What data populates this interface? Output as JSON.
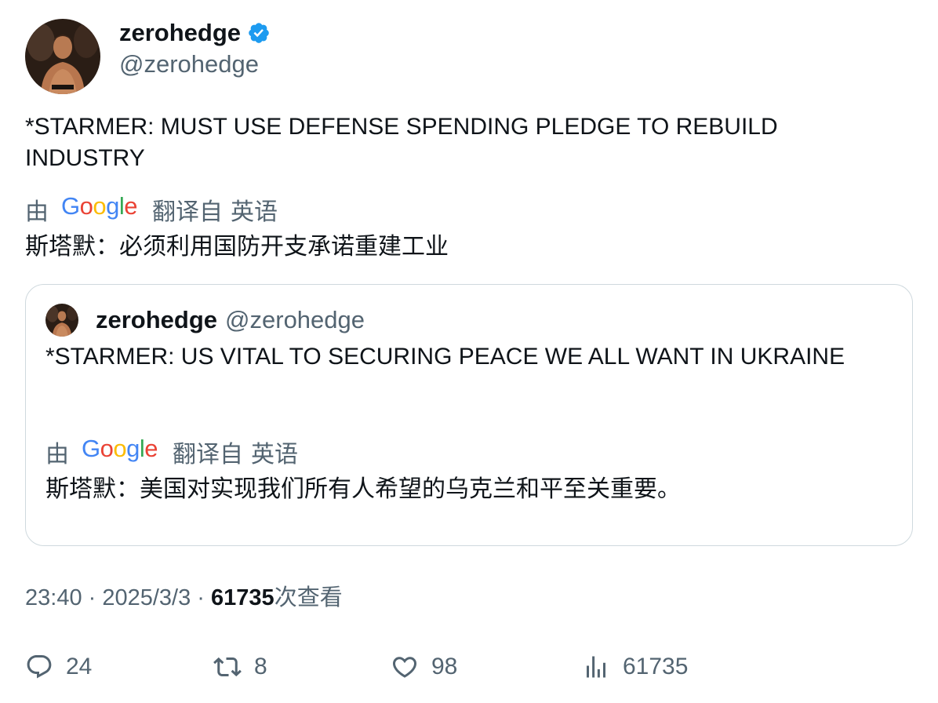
{
  "author": {
    "display_name": "zerohedge",
    "handle": "@zerohedge",
    "verified": true,
    "verified_icon": "verified-badge-icon",
    "verified_color": "#1d9bf0"
  },
  "tweet": {
    "text": "*STARMER: MUST USE DEFENSE SPENDING PLEDGE TO REBUILD INDUSTRY",
    "translation": {
      "by_label": "由",
      "service": "Google",
      "from_label": "翻译自",
      "language": "英语",
      "text": "斯塔默：必须利用国防开支承诺重建工业"
    }
  },
  "quoted_tweet": {
    "display_name": "zerohedge",
    "handle": "@zerohedge",
    "text": "*STARMER: US VITAL TO SECURING PEACE WE ALL WANT IN UKRAINE",
    "translation": {
      "by_label": "由",
      "service": "Google",
      "from_label": "翻译自",
      "language": "英语",
      "text": "斯塔默：美国对实现我们所有人希望的乌克兰和平至关重要。"
    }
  },
  "meta": {
    "time": "23:40",
    "separator": " · ",
    "date": "2025/3/3",
    "views_count": "61735",
    "views_label": "次查看"
  },
  "actions": {
    "replies": "24",
    "retweets": "8",
    "likes": "98",
    "views": "61735"
  },
  "colors": {
    "text_primary": "#0f1419",
    "text_secondary": "#536471",
    "border": "#cfd9de",
    "google_blue": "#4285F4",
    "google_red": "#EA4335",
    "google_yellow": "#FBBC05",
    "google_green": "#34A853"
  }
}
